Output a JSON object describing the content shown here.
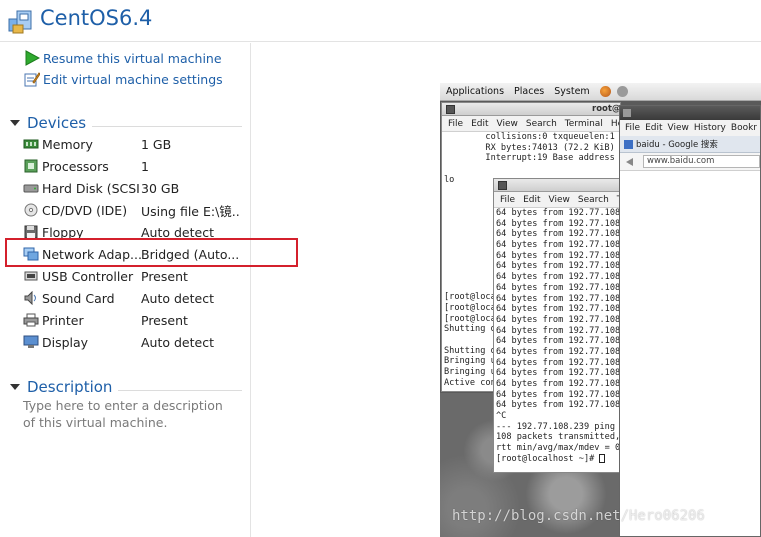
{
  "header": {
    "title": "CentOS6.4"
  },
  "actions": {
    "resume_label": "Resume this virtual machine",
    "edit_label": "Edit virtual machine settings"
  },
  "devices": {
    "title": "Devices",
    "items": [
      {
        "name": "Memory",
        "value": "1 GB",
        "icon": "memory-icon"
      },
      {
        "name": "Processors",
        "value": "1",
        "icon": "processor-icon"
      },
      {
        "name": "Hard Disk (SCSI)",
        "value": "30 GB",
        "icon": "hard-disk-icon"
      },
      {
        "name": "CD/DVD (IDE)",
        "value": "Using file E:\\镜...",
        "icon": "cd-dvd-icon"
      },
      {
        "name": "Floppy",
        "value": "Auto detect",
        "icon": "floppy-icon"
      },
      {
        "name": "Network Adap...",
        "value": "Bridged (Auto...",
        "icon": "network-adapter-icon"
      },
      {
        "name": "USB Controller",
        "value": "Present",
        "icon": "usb-icon"
      },
      {
        "name": "Sound Card",
        "value": "Auto detect",
        "icon": "sound-card-icon"
      },
      {
        "name": "Printer",
        "value": "Present",
        "icon": "printer-icon"
      },
      {
        "name": "Display",
        "value": "Auto detect",
        "icon": "display-icon"
      }
    ]
  },
  "description": {
    "title": "Description",
    "placeholder": "Type here to enter a description of this virtual machine."
  },
  "guest": {
    "panel_menus": [
      "Applications",
      "Places",
      "System"
    ],
    "term1_title": "root@",
    "term1_menu": [
      "File",
      "Edit",
      "View",
      "Search",
      "Terminal",
      "He"
    ],
    "term1_lines": [
      "        collisions:0 txqueuelen:1",
      "        RX bytes:74013 (72.2 KiB)",
      "        Interrupt:19 Base address",
      "",
      "lo",
      "",
      "",
      "",
      "",
      "",
      "",
      "",
      "",
      "",
      "",
      "[root@loca",
      "[root@loca",
      "[root@loca",
      "Shutting d",
      "",
      "Shutting d",
      "Bringing u",
      "Bringing u",
      "Active con",
      "",
      "[root@loca"
    ],
    "term2_menu": [
      "File",
      "Edit",
      "View",
      "Search",
      "Te"
    ],
    "term2_lines": [
      "64 bytes from 192.77.108",
      "64 bytes from 192.77.108",
      "64 bytes from 192.77.108",
      "64 bytes from 192.77.108",
      "64 bytes from 192.77.108",
      "64 bytes from 192.77.108",
      "64 bytes from 192.77.108",
      "64 bytes from 192.77.108",
      "64 bytes from 192.77.108",
      "64 bytes from 192.77.108",
      "64 bytes from 192.77.108",
      "64 bytes from 192.77.108",
      "64 bytes from 192.77.108",
      "64 bytes from 192.77.108",
      "64 bytes from 192.77.108",
      "64 bytes from 192.77.108",
      "64 bytes from 192.77.108",
      "64 bytes from 192.77.108",
      "64 bytes from 192.77.108",
      "^C",
      "--- 192.77.108.239 ping s",
      "108 packets transmitted,",
      "rtt min/avg/max/mdev = 0",
      "[root@localhost ~]# "
    ],
    "browser_menu": [
      "File",
      "Edit",
      "View",
      "History",
      "Bookr"
    ],
    "browser_tab": "baidu - Google 搜索",
    "browser_url": "www.baidu.com"
  },
  "watermark": "http://blog.csdn.net/Hero06206"
}
